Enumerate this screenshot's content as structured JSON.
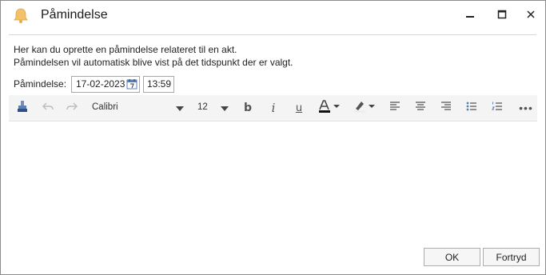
{
  "window": {
    "title": "Påmindelse"
  },
  "description": {
    "line1": "Her kan du oprette en påmindelse relateret til en akt.",
    "line2": "Påmindelsen vil automatisk blive vist på det tidspunkt der er valgt."
  },
  "reminder": {
    "label": "Påmindelse:",
    "date": "17-02-2023",
    "time": "13:59"
  },
  "toolbar": {
    "font_name": "Calibri",
    "font_size": "12",
    "bold_label": "b",
    "italic_label": "i",
    "underline_label": "u",
    "more_label": "•••"
  },
  "buttons": {
    "ok": "OK",
    "cancel": "Fortryd"
  },
  "colors": {
    "bell": "#f2c26b",
    "text_color_bar": "#111111",
    "icon": "#6a6a6a",
    "disabled_icon": "#bdbdbd"
  },
  "icons": [
    "bell-icon",
    "minimize-icon",
    "maximize-icon",
    "close-icon",
    "calendar-icon",
    "format-painter-icon",
    "undo-icon",
    "redo-icon",
    "chevron-down-icon",
    "text-color-icon",
    "highlight-icon",
    "align-left-icon",
    "align-center-icon",
    "align-right-icon",
    "bullet-list-icon",
    "numbered-list-icon"
  ]
}
